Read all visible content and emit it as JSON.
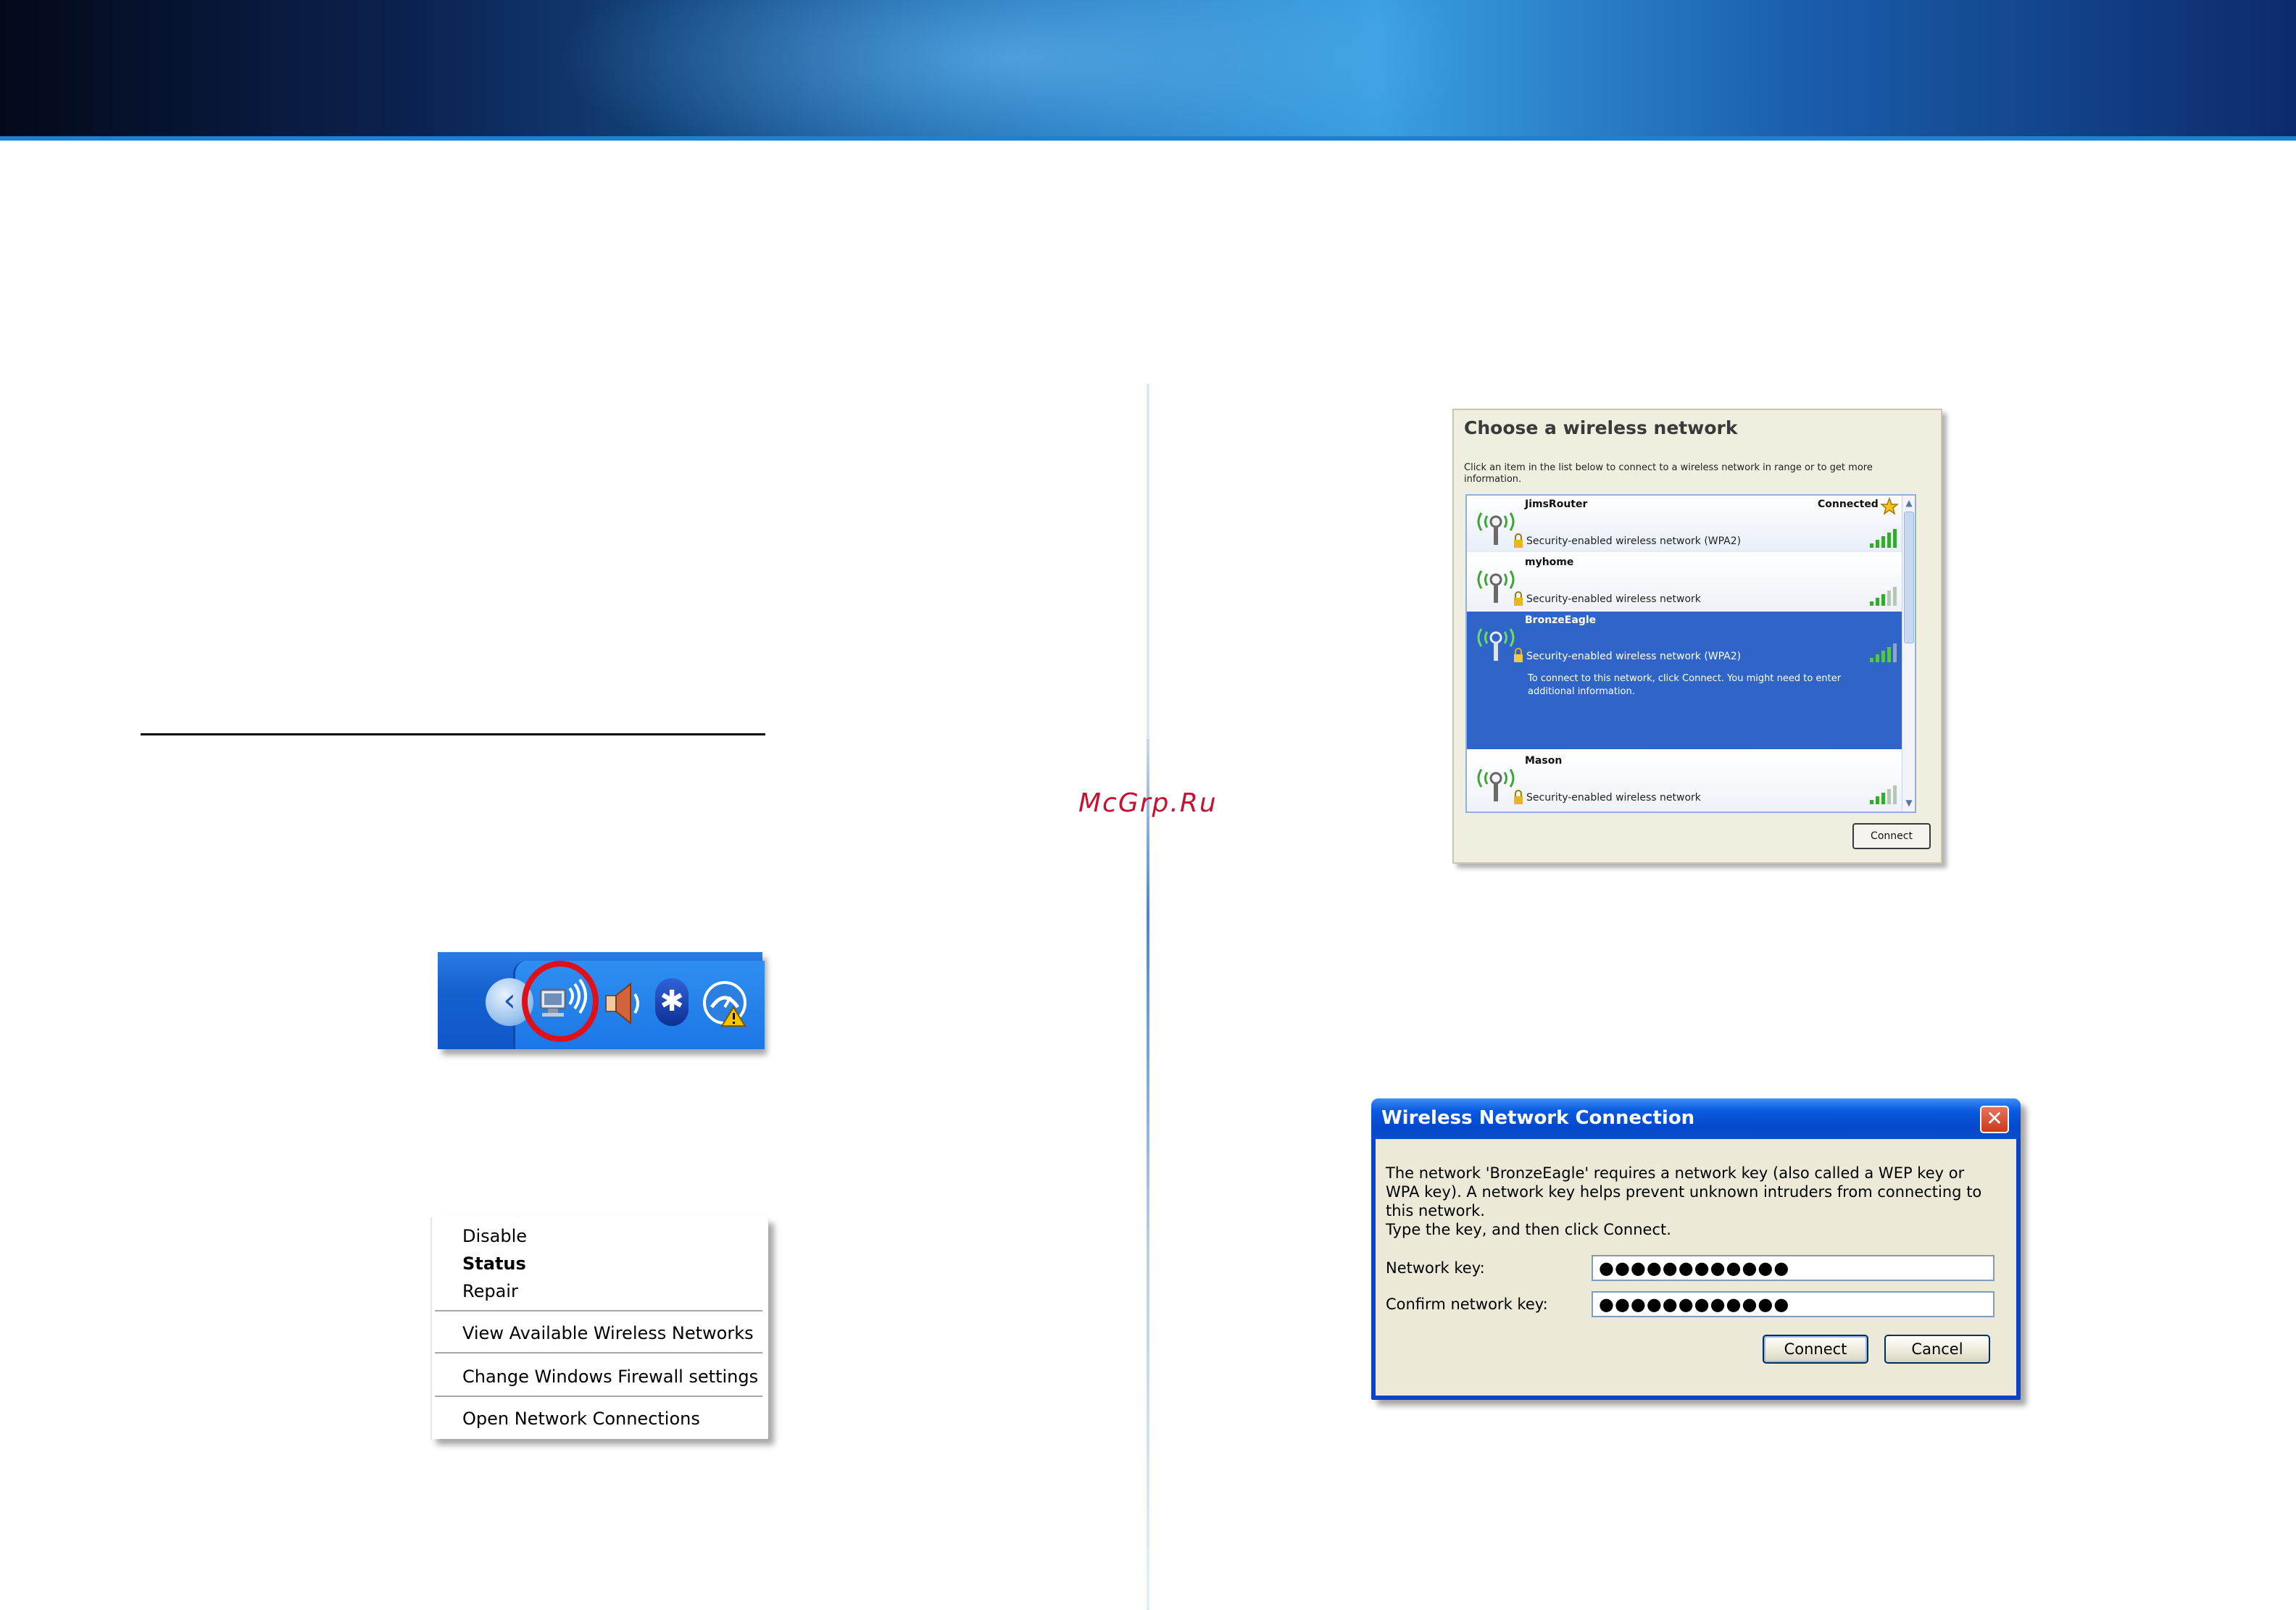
{
  "watermark": "McGrp.Ru",
  "context_menu": {
    "items": [
      {
        "label": "Disable"
      },
      {
        "label": "Status"
      },
      {
        "label": "Repair"
      },
      {
        "label": "View Available Wireless Networks"
      },
      {
        "label": "Change Windows Firewall settings"
      },
      {
        "label": "Open Network Connections"
      }
    ]
  },
  "choose_network": {
    "title": "Choose a wireless network",
    "description": "Click an item in the list below to connect to a wireless network in range or to get more information.",
    "networks": [
      {
        "name": "JimsRouter",
        "security": "Security-enabled wireless network (WPA2)",
        "status": "Connected"
      },
      {
        "name": "myhome",
        "security": "Security-enabled wireless network"
      },
      {
        "name": "BronzeEagle",
        "security": "Security-enabled wireless network (WPA2)",
        "tip": "To connect to this network, click Connect. You might need to enter additional information."
      },
      {
        "name": "Mason",
        "security": "Security-enabled wireless network"
      }
    ],
    "connect_label": "Connect"
  },
  "wireless_connection": {
    "title": "Wireless Network Connection",
    "message": "The network 'BronzeEagle' requires a network key (also called a WEP key or WPA key). A network key helps prevent unknown intruders from connecting to this network.",
    "instruction": "Type the key, and then click Connect.",
    "network_key_label": "Network key:",
    "network_key_value": "●●●●●●●●●●●●",
    "confirm_key_label": "Confirm network key:",
    "confirm_key_value": "●●●●●●●●●●●●",
    "connect_label": "Connect",
    "cancel_label": "Cancel"
  },
  "colors": {
    "selected_row": "#2f65c8",
    "xp_blue": "#0a42c8"
  }
}
